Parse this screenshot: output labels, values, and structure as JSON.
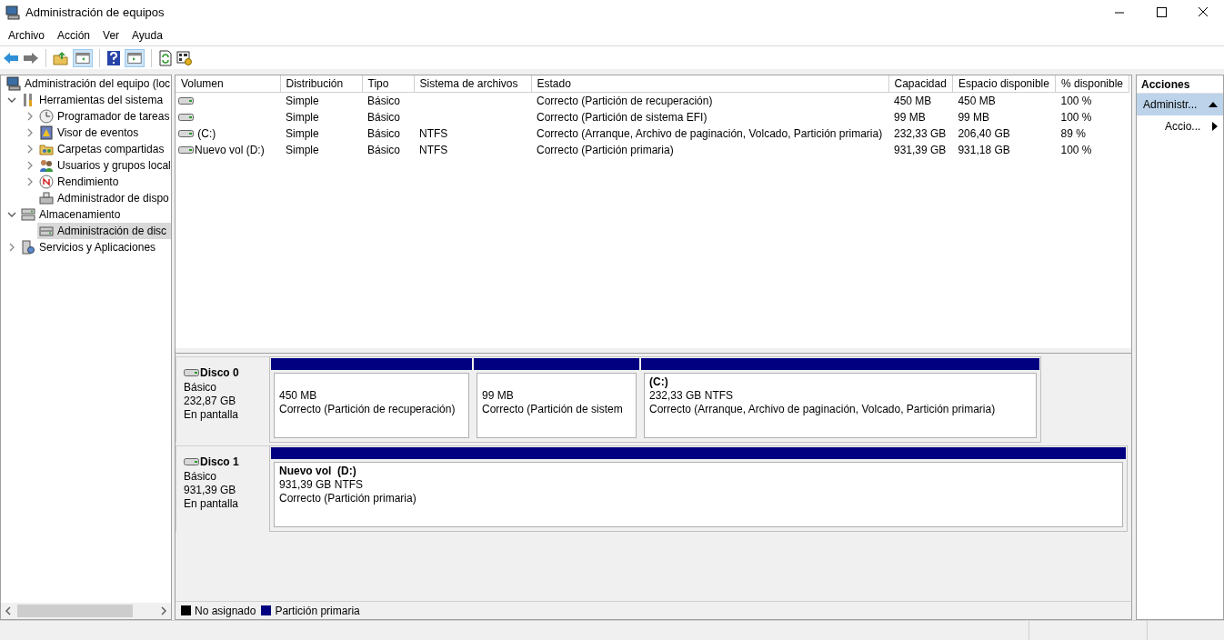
{
  "window": {
    "title": "Administración de equipos"
  },
  "menu": [
    "Archivo",
    "Acción",
    "Ver",
    "Ayuda"
  ],
  "tree": [
    {
      "label": "Administración del equipo (loc",
      "selected": false,
      "children": [
        {
          "label": "Herramientas del sistema",
          "selected": false,
          "expanded": true,
          "children": [
            {
              "label": "Programador de tareas",
              "selected": false,
              "expanded": false
            },
            {
              "label": "Visor de eventos",
              "selected": false,
              "expanded": false
            },
            {
              "label": "Carpetas compartidas",
              "selected": false,
              "expanded": false
            },
            {
              "label": "Usuarios y grupos local",
              "selected": false,
              "expanded": false
            },
            {
              "label": "Rendimiento",
              "selected": false,
              "expanded": false
            },
            {
              "label": "Administrador de dispo",
              "selected": false
            }
          ]
        },
        {
          "label": "Almacenamiento",
          "selected": false,
          "expanded": true,
          "children": [
            {
              "label": "Administración de disc",
              "selected": true
            }
          ]
        },
        {
          "label": "Servicios y Aplicaciones",
          "selected": false,
          "expanded": false
        }
      ]
    }
  ],
  "volumes": {
    "columns": [
      "Volumen",
      "Distribución",
      "Tipo",
      "Sistema de archivos",
      "Estado",
      "Capacidad",
      "Espacio disponible",
      "% disponible"
    ],
    "rows": [
      {
        "layout": "Simple",
        "type": "Básico",
        "status": "Correcto (Partición de recuperación)",
        "capacity": "450 MB",
        "free_space": "450 MB",
        "percent_free": "100 %"
      },
      {
        "layout": "Simple",
        "type": "Básico",
        "status": "Correcto (Partición de sistema EFI)",
        "capacity": "99 MB",
        "free_space": "99 MB",
        "percent_free": "100 %"
      },
      {
        "volume": " (C:)",
        "layout": "Simple",
        "type": "Básico",
        "file_system": "NTFS",
        "status": "Correcto (Arranque, Archivo de paginación, Volcado, Partición primaria)",
        "capacity": "232,33 GB",
        "free_space": "206,40 GB",
        "percent_free": "89 %"
      },
      {
        "volume": "Nuevo vol (D:)",
        "layout": "Simple",
        "type": "Básico",
        "file_system": "NTFS",
        "status": "Correcto (Partición primaria)",
        "capacity": "931,39 GB",
        "free_space": "931,18 GB",
        "percent_free": "100 %"
      }
    ]
  },
  "disks": [
    {
      "name": "Disco 0",
      "type": "Básico",
      "size": "232,87 GB",
      "state": "En pantalla",
      "partitions": [
        {
          "size": "450 MB",
          "status": "Correcto (Partición de recuperación)"
        },
        {
          "size": "99 MB",
          "status": "Correcto (Partición de sistem"
        },
        {
          "name": "(C:)",
          "size": "232,33 GB NTFS",
          "status": "Correcto (Arranque, Archivo de paginación, Volcado, Partición primaria)"
        }
      ]
    },
    {
      "name": "Disco 1",
      "type": "Básico",
      "size": "931,39 GB",
      "state": "En pantalla",
      "partitions": [
        {
          "name": "Nuevo vol  (D:)",
          "size": "931,39 GB NTFS",
          "status": "Correcto (Partición primaria)"
        }
      ]
    }
  ],
  "legend": [
    {
      "label": "No asignado",
      "color": "#000000"
    },
    {
      "label": "Partición primaria",
      "color": "#000080"
    }
  ],
  "actions": {
    "title": "Acciones",
    "items": [
      {
        "label": "Administr...",
        "kind": "group",
        "selected": true
      },
      {
        "label": "Accio...",
        "kind": "submenu",
        "selected": false
      }
    ]
  }
}
